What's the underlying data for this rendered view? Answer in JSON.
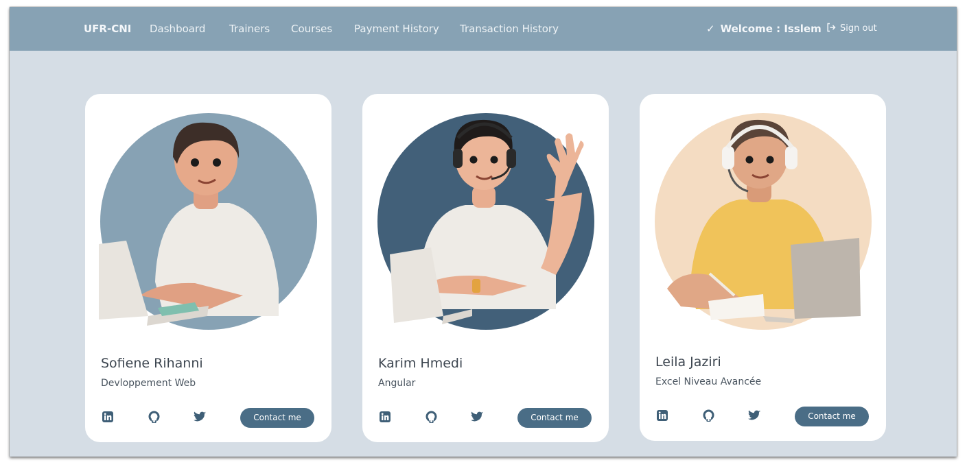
{
  "navbar": {
    "brand": "UFR-CNI",
    "links": [
      {
        "label": "Dashboard"
      },
      {
        "label": "Trainers"
      },
      {
        "label": "Courses"
      },
      {
        "label": "Payment History"
      },
      {
        "label": "Transaction History"
      }
    ],
    "welcome": "Welcome : Isslem",
    "signout": "Sign out"
  },
  "trainers": [
    {
      "name": "Sofiene Rihanni",
      "course": "Devloppement Web",
      "contact_label": "Contact me",
      "avatar_bg": "#87a2b4"
    },
    {
      "name": "Karim Hmedi",
      "course": "Angular",
      "contact_label": "Contact me",
      "avatar_bg": "#426079"
    },
    {
      "name": "Leila Jaziri",
      "course": "Excel Niveau Avancée",
      "contact_label": "Contact me",
      "avatar_bg": "#f4dcc2"
    }
  ],
  "social_icons": [
    "linkedin-icon",
    "github-icon",
    "twitter-icon"
  ],
  "colors": {
    "navbar": "#87a2b4",
    "page_bg": "#d5dde5",
    "button": "#4a6d86",
    "icon": "#3f5f77"
  }
}
